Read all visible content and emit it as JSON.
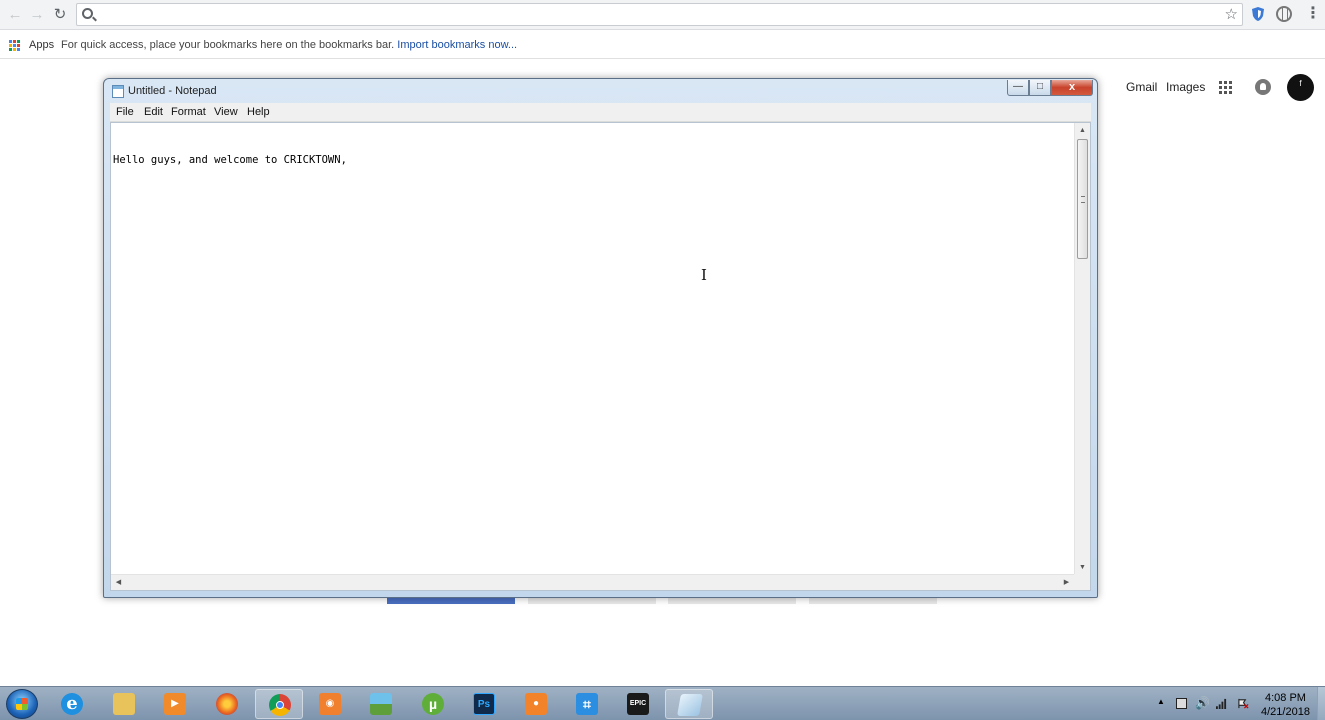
{
  "browser": {
    "omnibox_value": "",
    "omnibox_placeholder": "",
    "bookmarks_bar": {
      "apps_label": "Apps",
      "hint_text": "For quick access, place your bookmarks here on the bookmarks bar.",
      "import_link": "Import bookmarks now..."
    }
  },
  "google": {
    "gmail_label": "Gmail",
    "images_label": "Images",
    "avatar_letter": "f"
  },
  "notepad": {
    "title": "Untitled - Notepad",
    "menus": [
      "File",
      "Edit",
      "Format",
      "View",
      "Help"
    ],
    "text": "Hello guys, and welcome to CRICKTOWN,",
    "close_glyph": "x",
    "minimize_glyph": "—",
    "maximize_glyph": "□"
  },
  "taskbar": {
    "apps": [
      {
        "name": "Internet Explorer",
        "color": "#1f8fe0",
        "glyph": "e"
      },
      {
        "name": "File Explorer",
        "color": "#e8c25a",
        "glyph": ""
      },
      {
        "name": "Media Player",
        "color": "#f08a2a",
        "glyph": "▶"
      },
      {
        "name": "Firefox",
        "color": "#e9621f",
        "glyph": ""
      },
      {
        "name": "Chrome",
        "color": "#4285f4",
        "glyph": ""
      },
      {
        "name": "Screen Capture",
        "color": "#f07f2e",
        "glyph": "◉"
      },
      {
        "name": "Photo Viewer",
        "color": "#4aa0d5",
        "glyph": ""
      },
      {
        "name": "uTorrent",
        "color": "#5fae3a",
        "glyph": "µ"
      },
      {
        "name": "Photoshop",
        "color": "#0f2a4a",
        "glyph": "Ps"
      },
      {
        "name": "Recorder",
        "color": "#f2832a",
        "glyph": "●"
      },
      {
        "name": "Snipping",
        "color": "#2b8ee0",
        "glyph": "⌗"
      },
      {
        "name": "Epic Games",
        "color": "#1a1a1a",
        "glyph": "EPIC"
      },
      {
        "name": "Notepad",
        "color": "#cfe2f1",
        "glyph": ""
      }
    ],
    "clock_time": "4:08 PM",
    "clock_date": "4/21/2018"
  }
}
